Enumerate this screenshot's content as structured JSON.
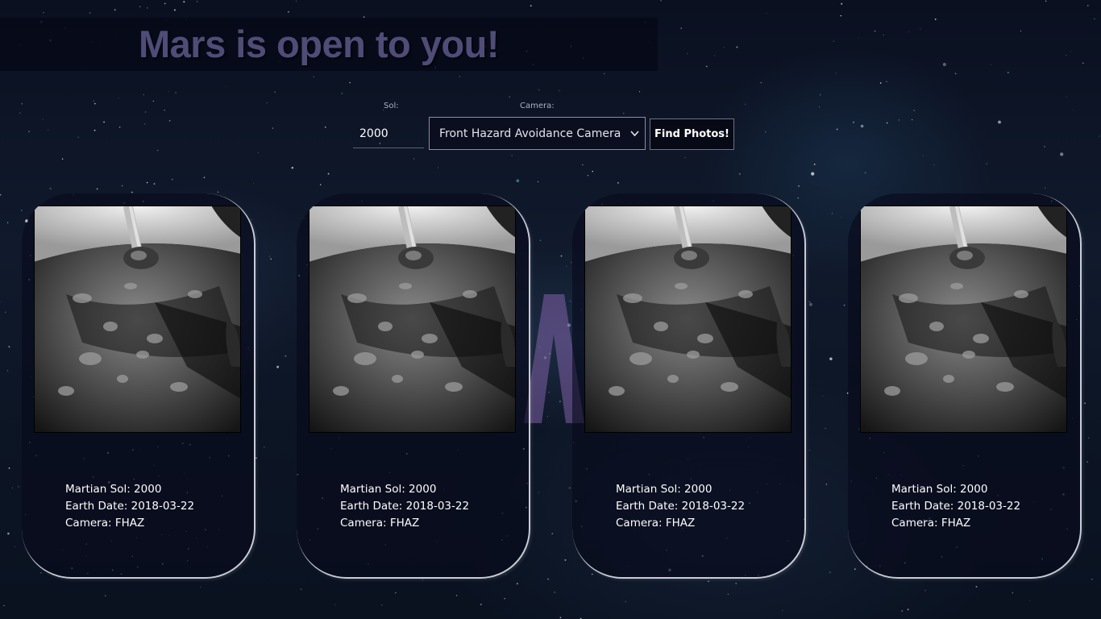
{
  "header": {
    "title": "Mars is open to you!"
  },
  "controls": {
    "sol_label": "Sol:",
    "sol_value": "2000",
    "camera_label": "Camera:",
    "camera_selected": "Front Hazard Avoidance Camera",
    "find_button": "Find Photos!"
  },
  "photos": [
    {
      "sol_label": "Martian Sol: 2000",
      "date_label": "Earth Date: 2018-03-22",
      "camera_label": "Camera: FHAZ"
    },
    {
      "sol_label": "Martian Sol: 2000",
      "date_label": "Earth Date: 2018-03-22",
      "camera_label": "Camera: FHAZ"
    },
    {
      "sol_label": "Martian Sol: 2000",
      "date_label": "Earth Date: 2018-03-22",
      "camera_label": "Camera: FHAZ"
    },
    {
      "sol_label": "Martian Sol: 2000",
      "date_label": "Earth Date: 2018-03-22",
      "camera_label": "Camera: FHAZ"
    }
  ],
  "icons": {
    "select_arrow": "chevron-down-icon"
  }
}
